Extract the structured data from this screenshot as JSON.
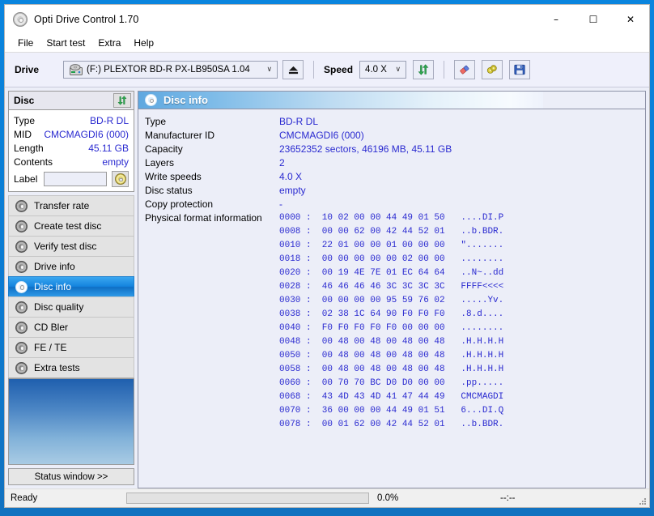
{
  "window": {
    "title": "Opti Drive Control 1.70",
    "app_icon": "cd-disc-icon",
    "minimize": "–",
    "maximize": "☐",
    "close": "✕"
  },
  "menubar": {
    "items": [
      "File",
      "Start test",
      "Extra",
      "Help"
    ]
  },
  "toolbar": {
    "drive_label": "Drive",
    "drive_value": "(F:)   PLEXTOR BD-R  PX-LB950SA 1.04",
    "drive_caret": "∨",
    "eject_button": "eject",
    "speed_label": "Speed",
    "speed_value": "4.0 X",
    "speed_caret": "∨",
    "refresh_button": "refresh",
    "erase_button": "erase",
    "settings_button": "settings",
    "save_button": "save"
  },
  "disc_panel": {
    "header": "Disc",
    "refresh_button": "refresh-disc",
    "rows": [
      {
        "key": "Type",
        "value": "BD-R DL"
      },
      {
        "key": "MID",
        "value": "CMCMAGDI6 (000)"
      },
      {
        "key": "Length",
        "value": "45.11 GB"
      },
      {
        "key": "Contents",
        "value": "empty"
      }
    ],
    "label_key": "Label",
    "label_value": "",
    "label_placeholder": "",
    "label_button": "read-label"
  },
  "nav": {
    "items": [
      {
        "label": "Transfer rate",
        "icon": "disc-icon",
        "active": false
      },
      {
        "label": "Create test disc",
        "icon": "disc-icon",
        "active": false
      },
      {
        "label": "Verify test disc",
        "icon": "disc-icon",
        "active": false
      },
      {
        "label": "Drive info",
        "icon": "disc-icon",
        "active": false
      },
      {
        "label": "Disc info",
        "icon": "disc-icon",
        "active": true
      },
      {
        "label": "Disc quality",
        "icon": "disc-icon",
        "active": false
      },
      {
        "label": "CD Bler",
        "icon": "disc-icon",
        "active": false
      },
      {
        "label": "FE / TE",
        "icon": "disc-icon",
        "active": false
      },
      {
        "label": "Extra tests",
        "icon": "disc-icon",
        "active": false
      }
    ]
  },
  "status_window_button": "Status window >>",
  "info": {
    "header_icon": "disc-icon",
    "header_title": "Disc info",
    "rows": [
      {
        "key": "Type",
        "value": "BD-R DL"
      },
      {
        "key": "Manufacturer ID",
        "value": "CMCMAGDI6 (000)"
      },
      {
        "key": "Capacity",
        "value": "23652352 sectors, 46196 MB, 45.11 GB"
      },
      {
        "key": "Layers",
        "value": "2"
      },
      {
        "key": "Write speeds",
        "value": "4.0 X"
      },
      {
        "key": "Disc status",
        "value": "empty"
      },
      {
        "key": "Copy protection",
        "value": "-"
      }
    ],
    "physical_format_key": "Physical format information",
    "hex_lines": [
      "0000 :  10 02 00 00 44 49 01 50   ....DI.P",
      "0008 :  00 00 62 00 42 44 52 01   ..b.BDR.",
      "0010 :  22 01 00 00 01 00 00 00   \".......",
      "0018 :  00 00 00 00 00 02 00 00   ........",
      "0020 :  00 19 4E 7E 01 EC 64 64   ..N~..dd",
      "0028 :  46 46 46 46 3C 3C 3C 3C   FFFF<<<<",
      "0030 :  00 00 00 00 95 59 76 02   .....Yv.",
      "0038 :  02 38 1C 64 90 F0 F0 F0   .8.d....",
      "0040 :  F0 F0 F0 F0 F0 00 00 00   ........",
      "0048 :  00 48 00 48 00 48 00 48   .H.H.H.H",
      "0050 :  00 48 00 48 00 48 00 48   .H.H.H.H",
      "0058 :  00 48 00 48 00 48 00 48   .H.H.H.H",
      "0060 :  00 70 70 BC D0 D0 00 00   .pp.....",
      "0068 :  43 4D 43 4D 41 47 44 49   CMCMAGDI",
      "0070 :  36 00 00 00 44 49 01 51   6...DI.Q",
      "0078 :  00 01 62 00 42 44 52 01   ..b.BDR."
    ]
  },
  "statusbar": {
    "ready": "Ready",
    "progress_percent": "0.0%",
    "progress_value": 0,
    "time": "--:--"
  },
  "colors": {
    "accent_blue": "#0b7bd4",
    "value_text": "#2a2ad0",
    "panel_bg": "#eceef8",
    "nav_active": "#1484de"
  }
}
